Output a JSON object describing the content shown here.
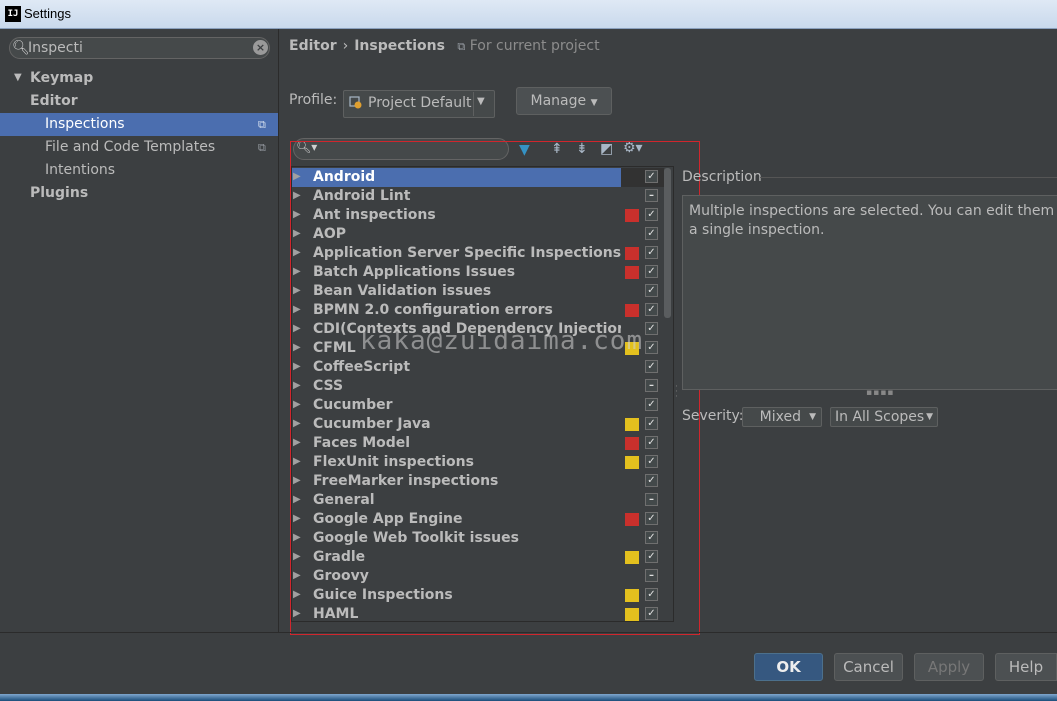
{
  "window": {
    "title": "Settings",
    "logo_text": "IJ"
  },
  "search": {
    "value": "Inspecti"
  },
  "sidebar": {
    "items": [
      {
        "label": "Keymap"
      },
      {
        "label": "Editor"
      },
      {
        "label": "Inspections"
      },
      {
        "label": "File and Code Templates"
      },
      {
        "label": "Intentions"
      },
      {
        "label": "Plugins"
      }
    ]
  },
  "breadcrumb": {
    "part1": "Editor",
    "part2": "Inspections",
    "scope": "For current project"
  },
  "profile": {
    "label": "Profile:",
    "value": "Project Default"
  },
  "manage": {
    "label": "Manage"
  },
  "tree": {
    "rows": [
      {
        "label": "Android",
        "severity": "none",
        "check": "checked",
        "selected": true
      },
      {
        "label": "Android Lint",
        "severity": "none",
        "check": "partial"
      },
      {
        "label": "Ant inspections",
        "severity": "error",
        "check": "checked"
      },
      {
        "label": "AOP",
        "severity": "none",
        "check": "checked"
      },
      {
        "label": "Application Server Specific Inspections",
        "severity": "error",
        "check": "checked"
      },
      {
        "label": "Batch Applications Issues",
        "severity": "error",
        "check": "checked"
      },
      {
        "label": "Bean Validation issues",
        "severity": "none",
        "check": "checked"
      },
      {
        "label": "BPMN 2.0 configuration errors",
        "severity": "error",
        "check": "checked"
      },
      {
        "label": "CDI(Contexts and Dependency Injection) issu",
        "severity": "none",
        "check": "checked"
      },
      {
        "label": "CFML",
        "severity": "warning",
        "check": "checked"
      },
      {
        "label": "CoffeeScript",
        "severity": "none",
        "check": "checked"
      },
      {
        "label": "CSS",
        "severity": "none",
        "check": "partial"
      },
      {
        "label": "Cucumber",
        "severity": "none",
        "check": "checked"
      },
      {
        "label": "Cucumber Java",
        "severity": "warning",
        "check": "checked"
      },
      {
        "label": "Faces Model",
        "severity": "error",
        "check": "checked"
      },
      {
        "label": "FlexUnit inspections",
        "severity": "warning",
        "check": "checked"
      },
      {
        "label": "FreeMarker inspections",
        "severity": "none",
        "check": "checked"
      },
      {
        "label": "General",
        "severity": "none",
        "check": "partial"
      },
      {
        "label": "Google App Engine",
        "severity": "error",
        "check": "checked"
      },
      {
        "label": "Google Web Toolkit issues",
        "severity": "none",
        "check": "checked"
      },
      {
        "label": "Gradle",
        "severity": "warning",
        "check": "checked"
      },
      {
        "label": "Groovy",
        "severity": "none",
        "check": "partial"
      },
      {
        "label": "Guice Inspections",
        "severity": "warning",
        "check": "checked"
      },
      {
        "label": "HAML",
        "severity": "warning",
        "check": "checked"
      }
    ]
  },
  "description": {
    "label": "Description",
    "line1": "Multiple inspections are selected. You can edit them as",
    "line2": "a single inspection."
  },
  "severity": {
    "label": "Severity:",
    "value": "Mixed"
  },
  "scope": {
    "value": "In All Scopes"
  },
  "watermark": "kaka@zuidaima.com",
  "buttons": {
    "ok": "OK",
    "cancel": "Cancel",
    "apply": "Apply",
    "help": "Help"
  },
  "colors": {
    "error": "#c9302c",
    "warning": "#e3c01e",
    "selection": "#4b6eaf",
    "highlight_frame": "#d0262d"
  }
}
